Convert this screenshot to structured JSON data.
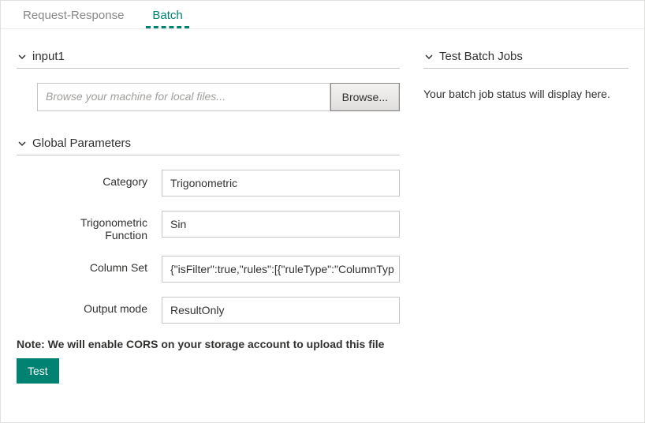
{
  "tabs": {
    "request_response": "Request-Response",
    "batch": "Batch"
  },
  "sections": {
    "input1": "input1",
    "global_parameters": "Global Parameters",
    "test_batch_jobs": "Test Batch Jobs"
  },
  "file": {
    "placeholder": "Browse your machine for local files...",
    "browse_label": "Browse..."
  },
  "params": {
    "category": {
      "label": "Category",
      "value": "Trigonometric"
    },
    "trig_function": {
      "label": "Trigonometric Function",
      "value": "Sin"
    },
    "column_set": {
      "label": "Column Set",
      "value": "{\"isFilter\":true,\"rules\":[{\"ruleType\":\"ColumnTyp"
    },
    "output_mode": {
      "label": "Output mode",
      "value": "ResultOnly"
    }
  },
  "note": "Note: We will enable CORS on your storage account to upload this file",
  "buttons": {
    "test": "Test"
  },
  "status": {
    "message": "Your batch job status will display here."
  }
}
